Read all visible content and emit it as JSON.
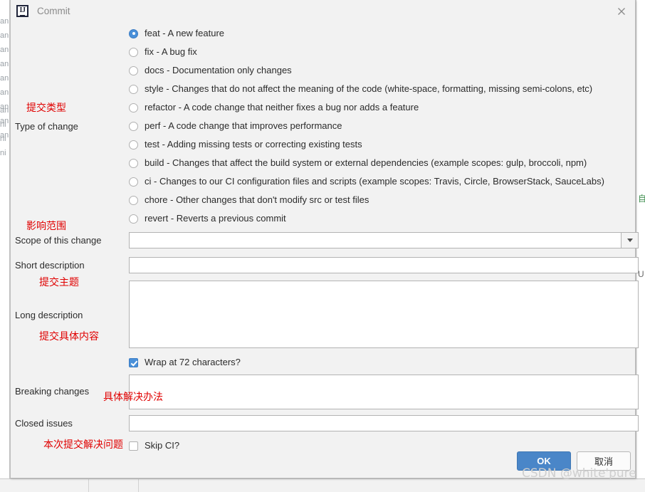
{
  "window": {
    "title": "Commit",
    "app_icon": "intellij-idea-icon",
    "close_icon": "close-icon"
  },
  "form": {
    "labels": {
      "type_of_change": "Type of change",
      "scope": "Scope of this change",
      "short_description": "Short description",
      "long_description": "Long description",
      "breaking_changes": "Breaking changes",
      "closed_issues": "Closed issues"
    },
    "annotations": {
      "type_of_change": "提交类型",
      "scope": "影响范围",
      "short_description": "提交主题",
      "long_description": "提交具体内容",
      "breaking_changes": "具体解决办法",
      "closed_issues": "本次提交解决问题"
    },
    "change_types": [
      {
        "value": "feat",
        "label": "feat - A new feature",
        "selected": true
      },
      {
        "value": "fix",
        "label": "fix - A bug fix",
        "selected": false
      },
      {
        "value": "docs",
        "label": "docs - Documentation only changes",
        "selected": false
      },
      {
        "value": "style",
        "label": "style - Changes that do not affect the meaning of the code (white-space, formatting, missing semi-colons, etc)",
        "selected": false
      },
      {
        "value": "refactor",
        "label": "refactor - A code change that neither fixes a bug nor adds a feature",
        "selected": false
      },
      {
        "value": "perf",
        "label": "perf - A code change that improves performance",
        "selected": false
      },
      {
        "value": "test",
        "label": "test - Adding missing tests or correcting existing tests",
        "selected": false
      },
      {
        "value": "build",
        "label": "build - Changes that affect the build system or external dependencies (example scopes: gulp, broccoli, npm)",
        "selected": false
      },
      {
        "value": "ci",
        "label": "ci - Changes to our CI configuration files and scripts (example scopes: Travis, Circle, BrowserStack, SauceLabs)",
        "selected": false
      },
      {
        "value": "chore",
        "label": "chore - Other changes that don't modify src or test files",
        "selected": false
      },
      {
        "value": "revert",
        "label": "revert - Reverts a previous commit",
        "selected": false
      }
    ],
    "fields": {
      "scope_value": "",
      "short_description_value": "",
      "long_description_value": "",
      "breaking_changes_value": "",
      "closed_issues_value": ""
    },
    "checkboxes": {
      "wrap_label": "Wrap at 72 characters?",
      "wrap_checked": true,
      "skip_ci_label": "Skip CI?",
      "skip_ci_checked": false
    }
  },
  "footer": {
    "ok_label": "OK",
    "cancel_label": "取消"
  },
  "watermark": "CSDN @white'pure",
  "background": {
    "left_fragments": [
      "an",
      "an",
      "an",
      "an",
      "an",
      "an",
      "an",
      "an",
      "an",
      "an",
      "ni",
      "ni",
      "ni"
    ],
    "right_green_char": "自",
    "right_gray_char": "U"
  },
  "colors": {
    "accent": "#4a90d9",
    "dialog_bg": "#f2f2f2",
    "annotation_red": "#e00000",
    "ok_button": "#4a86c8"
  }
}
